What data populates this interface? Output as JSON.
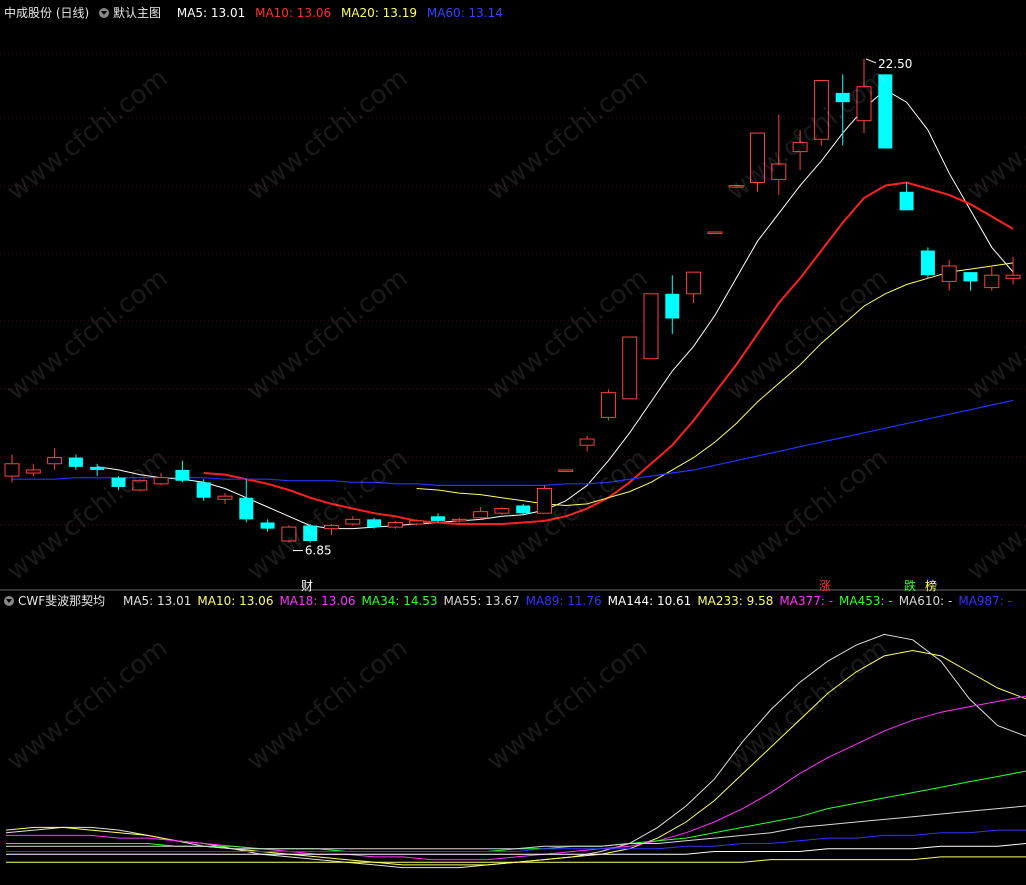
{
  "main_header": {
    "stock": "中成股份 (日线)",
    "template": "默认主图",
    "ma5": "MA5: 13.01",
    "ma10": "MA10: 13.06",
    "ma20": "MA20: 13.19",
    "ma60": "MA60: 13.14"
  },
  "sub_header": {
    "name": "CWF斐波那契均",
    "items": [
      {
        "label": "MA5: 13.01",
        "color": "#e0e0e0"
      },
      {
        "label": "MA10: 13.06",
        "color": "#ffff66"
      },
      {
        "label": "MA18: 13.06",
        "color": "#ff33ff"
      },
      {
        "label": "MA34: 14.53",
        "color": "#33ff33"
      },
      {
        "label": "MA55: 13.67",
        "color": "#d8d8d8"
      },
      {
        "label": "MA89: 11.76",
        "color": "#3333ff"
      },
      {
        "label": "MA144: 10.61",
        "color": "#ffffff"
      },
      {
        "label": "MA233: 9.58",
        "color": "#ffff66"
      },
      {
        "label": "MA377: -",
        "color": "#ff33ff"
      },
      {
        "label": "MA453: -",
        "color": "#33ff33"
      },
      {
        "label": "MA610: -",
        "color": "#d8d8d8"
      },
      {
        "label": "MA987: -",
        "color": "#3333ff"
      }
    ]
  },
  "markers": {
    "high_label": "22.50",
    "low_label": "6.85",
    "cai": "财",
    "zhang": "涨",
    "die": "跌",
    "bang": "榜"
  },
  "watermark": "www.cfchi.com",
  "colors": {
    "up": "#ff4040",
    "down": "#00ffff",
    "ma5": "#ffffff",
    "ma10": "#ff2020",
    "ma20": "#ffff66",
    "ma60": "#2233ff"
  },
  "chart_data": [
    {
      "type": "candlestick",
      "title": "中成股份 (日线)",
      "ylim": [
        5.8,
        23.5
      ],
      "candles": [
        {
          "o": 9.0,
          "c": 9.4,
          "h": 9.7,
          "l": 8.8
        },
        {
          "o": 9.1,
          "c": 9.2,
          "h": 9.4,
          "l": 9.0
        },
        {
          "o": 9.4,
          "c": 9.6,
          "h": 9.9,
          "l": 9.2
        },
        {
          "o": 9.6,
          "c": 9.3,
          "h": 9.7,
          "l": 9.2
        },
        {
          "o": 9.3,
          "c": 9.2,
          "h": 9.4,
          "l": 9.0
        },
        {
          "o": 8.95,
          "c": 8.65,
          "h": 9.0,
          "l": 8.55
        },
        {
          "o": 8.55,
          "c": 8.85,
          "h": 8.9,
          "l": 8.5
        },
        {
          "o": 8.75,
          "c": 8.95,
          "h": 9.1,
          "l": 8.7
        },
        {
          "o": 9.2,
          "c": 8.85,
          "h": 9.5,
          "l": 8.8
        },
        {
          "o": 8.8,
          "c": 8.3,
          "h": 8.9,
          "l": 8.2
        },
        {
          "o": 8.25,
          "c": 8.35,
          "h": 8.45,
          "l": 8.1
        },
        {
          "o": 8.3,
          "c": 7.6,
          "h": 8.9,
          "l": 7.5
        },
        {
          "o": 7.5,
          "c": 7.3,
          "h": 7.6,
          "l": 7.2
        },
        {
          "o": 6.9,
          "c": 7.35,
          "h": 7.4,
          "l": 6.85
        },
        {
          "o": 7.4,
          "c": 6.9,
          "h": 7.45,
          "l": 6.85
        },
        {
          "o": 7.3,
          "c": 7.4,
          "h": 7.45,
          "l": 7.1
        },
        {
          "o": 7.45,
          "c": 7.6,
          "h": 7.7,
          "l": 7.4
        },
        {
          "o": 7.6,
          "c": 7.35,
          "h": 7.65,
          "l": 7.3
        },
        {
          "o": 7.35,
          "c": 7.5,
          "h": 7.55,
          "l": 7.3
        },
        {
          "o": 7.45,
          "c": 7.55,
          "h": 7.6,
          "l": 7.4
        },
        {
          "o": 7.7,
          "c": 7.55,
          "h": 7.8,
          "l": 7.5
        },
        {
          "o": 7.55,
          "c": 7.6,
          "h": 7.65,
          "l": 7.5
        },
        {
          "o": 7.65,
          "c": 7.85,
          "h": 8.0,
          "l": 7.6
        },
        {
          "o": 7.8,
          "c": 7.95,
          "h": 8.0,
          "l": 7.75
        },
        {
          "o": 8.05,
          "c": 7.8,
          "h": 8.1,
          "l": 7.75
        },
        {
          "o": 7.8,
          "c": 8.6,
          "h": 8.7,
          "l": 7.8
        },
        {
          "o": 9.2,
          "c": 9.2,
          "h": 9.2,
          "l": 9.2
        },
        {
          "o": 10.0,
          "c": 10.2,
          "h": 10.3,
          "l": 9.8
        },
        {
          "o": 10.9,
          "c": 11.7,
          "h": 11.8,
          "l": 10.8
        },
        {
          "o": 11.5,
          "c": 13.5,
          "h": 13.5,
          "l": 11.5
        },
        {
          "o": 12.8,
          "c": 14.9,
          "h": 14.9,
          "l": 12.8
        },
        {
          "o": 14.9,
          "c": 14.1,
          "h": 15.5,
          "l": 13.6
        },
        {
          "o": 14.9,
          "c": 15.6,
          "h": 15.6,
          "l": 14.6
        },
        {
          "o": 16.9,
          "c": 16.9,
          "h": 16.9,
          "l": 16.9
        },
        {
          "o": 18.4,
          "c": 18.4,
          "h": 18.4,
          "l": 18.4
        },
        {
          "o": 18.5,
          "c": 20.1,
          "h": 20.1,
          "l": 18.2
        },
        {
          "o": 18.6,
          "c": 19.1,
          "h": 20.7,
          "l": 18.1
        },
        {
          "o": 19.5,
          "c": 19.8,
          "h": 20.2,
          "l": 18.9
        },
        {
          "o": 19.9,
          "c": 21.8,
          "h": 21.8,
          "l": 19.7
        },
        {
          "o": 21.4,
          "c": 21.1,
          "h": 22.0,
          "l": 19.7
        },
        {
          "o": 20.5,
          "c": 21.6,
          "h": 22.5,
          "l": 20.1
        },
        {
          "o": 22.0,
          "c": 19.6,
          "h": 22.0,
          "l": 19.6
        },
        {
          "o": 18.2,
          "c": 17.6,
          "h": 18.5,
          "l": 17.6
        },
        {
          "o": 16.3,
          "c": 15.5,
          "h": 16.4,
          "l": 15.4
        },
        {
          "o": 15.3,
          "c": 15.8,
          "h": 16.0,
          "l": 15.0
        },
        {
          "o": 15.6,
          "c": 15.3,
          "h": 15.6,
          "l": 15.0
        },
        {
          "o": 15.1,
          "c": 15.5,
          "h": 15.8,
          "l": 15.0
        },
        {
          "o": 15.4,
          "c": 15.5,
          "h": 16.1,
          "l": 15.2
        }
      ],
      "series": [
        {
          "name": "MA5",
          "color": "#ffffff",
          "values": [
            null,
            null,
            null,
            null,
            9.3,
            9.2,
            9.05,
            8.95,
            8.9,
            8.8,
            8.6,
            8.3,
            8.0,
            7.7,
            7.4,
            7.3,
            7.3,
            7.35,
            7.4,
            7.45,
            7.5,
            7.55,
            7.6,
            7.7,
            7.75,
            7.9,
            8.2,
            8.7,
            9.5,
            10.4,
            11.4,
            12.4,
            13.2,
            14.2,
            15.4,
            16.6,
            17.5,
            18.4,
            19.2,
            20.1,
            20.9,
            21.5,
            21.1,
            20.2,
            18.8,
            17.6,
            16.4,
            15.6
          ]
        },
        {
          "name": "MA10",
          "color": "#ff2020",
          "values": [
            null,
            null,
            null,
            null,
            null,
            null,
            null,
            null,
            null,
            9.1,
            9.05,
            8.9,
            8.75,
            8.55,
            8.3,
            8.1,
            7.95,
            7.8,
            7.7,
            7.55,
            7.5,
            7.45,
            7.45,
            7.45,
            7.5,
            7.55,
            7.7,
            7.95,
            8.3,
            8.8,
            9.4,
            10.0,
            10.8,
            11.7,
            12.6,
            13.6,
            14.6,
            15.4,
            16.3,
            17.2,
            18.0,
            18.4,
            18.5,
            18.3,
            18.1,
            17.8,
            17.4,
            17.0
          ]
        },
        {
          "name": "MA20",
          "color": "#ffff66",
          "values": [
            null,
            null,
            null,
            null,
            null,
            null,
            null,
            null,
            null,
            null,
            null,
            null,
            null,
            null,
            null,
            null,
            null,
            null,
            null,
            8.6,
            8.55,
            8.45,
            8.4,
            8.3,
            8.2,
            8.1,
            8.05,
            8.1,
            8.3,
            8.5,
            8.8,
            9.2,
            9.6,
            10.1,
            10.7,
            11.4,
            12.0,
            12.6,
            13.3,
            13.9,
            14.5,
            14.9,
            15.2,
            15.4,
            15.6,
            15.7,
            15.8,
            15.9
          ]
        },
        {
          "name": "MA60",
          "color": "#2233ff",
          "values": [
            8.9,
            8.9,
            8.9,
            8.95,
            8.95,
            8.95,
            8.95,
            8.95,
            8.95,
            8.95,
            8.9,
            8.9,
            8.9,
            8.85,
            8.85,
            8.85,
            8.8,
            8.8,
            8.75,
            8.75,
            8.7,
            8.7,
            8.7,
            8.7,
            8.7,
            8.7,
            8.75,
            8.75,
            8.8,
            8.9,
            9.0,
            9.1,
            9.2,
            9.35,
            9.5,
            9.65,
            9.8,
            9.95,
            10.1,
            10.25,
            10.4,
            10.55,
            10.7,
            10.85,
            11.0,
            11.15,
            11.3,
            11.45
          ]
        }
      ]
    },
    {
      "type": "line",
      "title": "CWF斐波那契均",
      "ylim": [
        0,
        100
      ],
      "series": [
        {
          "name": "MA5",
          "color": "#e0e0e0",
          "values": [
            18,
            19,
            20,
            20,
            19,
            17,
            15,
            13,
            12,
            10,
            9,
            8,
            7,
            6,
            5,
            5,
            5,
            6,
            7,
            8,
            9,
            11,
            14,
            20,
            28,
            38,
            52,
            64,
            74,
            82,
            88,
            92,
            90,
            82,
            68,
            58,
            54
          ]
        },
        {
          "name": "MA10",
          "color": "#ffff66",
          "values": [
            19,
            20,
            20,
            19,
            18,
            17,
            15,
            14,
            12,
            11,
            10,
            9,
            8,
            7,
            6,
            6,
            6,
            6,
            7,
            8,
            9,
            10,
            12,
            16,
            22,
            30,
            40,
            50,
            60,
            70,
            78,
            84,
            86,
            84,
            78,
            72,
            68
          ]
        },
        {
          "name": "MA18",
          "color": "#ff33ff",
          "values": [
            17,
            17,
            17,
            17,
            16,
            16,
            15,
            14,
            13,
            12,
            11,
            10,
            10,
            9,
            9,
            8,
            8,
            8,
            9,
            10,
            11,
            12,
            13,
            15,
            18,
            22,
            27,
            33,
            40,
            46,
            51,
            56,
            60,
            63,
            65,
            67,
            69
          ]
        },
        {
          "name": "MA34",
          "color": "#33ff33",
          "values": [
            14,
            14,
            14,
            14,
            14,
            14,
            13,
            13,
            13,
            12,
            12,
            12,
            11,
            11,
            11,
            11,
            11,
            11,
            12,
            12,
            13,
            13,
            14,
            15,
            16,
            18,
            20,
            22,
            24,
            27,
            29,
            31,
            33,
            35,
            37,
            39,
            41
          ]
        },
        {
          "name": "MA55",
          "color": "#d8d8d8",
          "values": [
            13,
            13,
            13,
            13,
            13,
            13,
            13,
            13,
            12,
            12,
            12,
            12,
            12,
            12,
            12,
            12,
            12,
            12,
            12,
            13,
            13,
            13,
            14,
            14,
            15,
            16,
            17,
            18,
            20,
            21,
            22,
            23,
            24,
            25,
            26,
            27,
            28
          ]
        },
        {
          "name": "MA89",
          "color": "#3333ff",
          "values": [
            11,
            11,
            11,
            11,
            11,
            11,
            11,
            11,
            11,
            11,
            11,
            11,
            11,
            11,
            11,
            11,
            11,
            11,
            11,
            12,
            12,
            12,
            12,
            12,
            13,
            13,
            14,
            14,
            15,
            16,
            16,
            17,
            17,
            18,
            18,
            19,
            19
          ]
        },
        {
          "name": "MA144",
          "color": "#ffffff",
          "values": [
            10,
            10,
            10,
            10,
            10,
            10,
            10,
            10,
            10,
            10,
            10,
            10,
            10,
            10,
            10,
            10,
            10,
            10,
            10,
            10,
            10,
            10,
            10,
            10,
            10,
            11,
            11,
            11,
            11,
            12,
            12,
            12,
            12,
            13,
            13,
            13,
            14
          ]
        },
        {
          "name": "MA233",
          "color": "#ffff66",
          "values": [
            7,
            7,
            7,
            7,
            7,
            7,
            7,
            7,
            7,
            7,
            7,
            7,
            7,
            7,
            7,
            7,
            7,
            7,
            7,
            7,
            7,
            7,
            7,
            7,
            7,
            7,
            7,
            8,
            8,
            8,
            8,
            8,
            8,
            9,
            9,
            9,
            9
          ]
        }
      ]
    }
  ]
}
